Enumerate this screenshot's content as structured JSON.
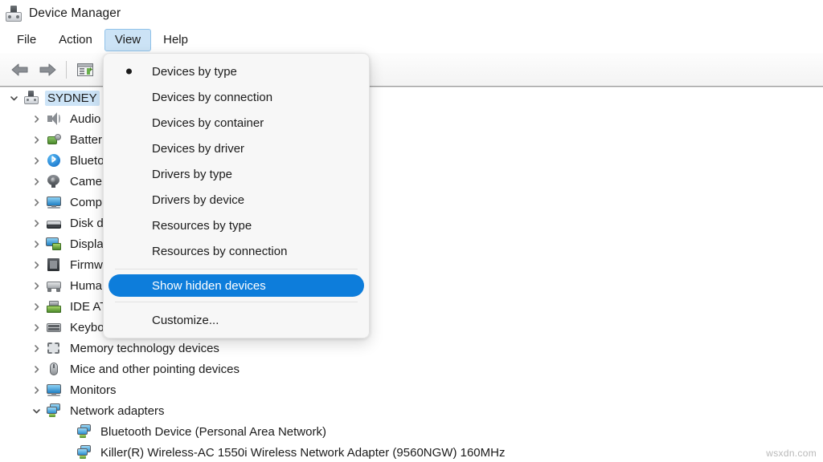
{
  "window": {
    "title": "Device Manager",
    "icon": "device-manager-icon"
  },
  "menubar": {
    "items": [
      {
        "label": "File",
        "open": false
      },
      {
        "label": "Action",
        "open": false
      },
      {
        "label": "View",
        "open": true
      },
      {
        "label": "Help",
        "open": false
      }
    ]
  },
  "toolbar": {
    "buttons": [
      {
        "name": "back-button",
        "icon": "left-arrow-icon"
      },
      {
        "name": "forward-button",
        "icon": "right-arrow-icon"
      },
      {
        "name": "properties-button",
        "icon": "properties-window-icon"
      }
    ]
  },
  "view_menu": {
    "items": [
      {
        "label": "Devices by type",
        "bullet": true,
        "highlight": false,
        "separator_before": false
      },
      {
        "label": "Devices by connection",
        "bullet": false,
        "highlight": false,
        "separator_before": false
      },
      {
        "label": "Devices by container",
        "bullet": false,
        "highlight": false,
        "separator_before": false
      },
      {
        "label": "Devices by driver",
        "bullet": false,
        "highlight": false,
        "separator_before": false
      },
      {
        "label": "Drivers by type",
        "bullet": false,
        "highlight": false,
        "separator_before": false
      },
      {
        "label": "Drivers by device",
        "bullet": false,
        "highlight": false,
        "separator_before": false
      },
      {
        "label": "Resources by type",
        "bullet": false,
        "highlight": false,
        "separator_before": false
      },
      {
        "label": "Resources by connection",
        "bullet": false,
        "highlight": false,
        "separator_before": false
      },
      {
        "label": "Show hidden devices",
        "bullet": false,
        "highlight": true,
        "separator_before": true
      },
      {
        "label": "Customize...",
        "bullet": false,
        "highlight": false,
        "separator_before": true
      }
    ]
  },
  "tree": {
    "rows": [
      {
        "label": "SYDNEY",
        "indent": 0,
        "chevron": "down",
        "icon": "computer-root-icon",
        "selected": true
      },
      {
        "label": "Audio inputs and outputs",
        "indent": 1,
        "chevron": "right",
        "icon": "speaker-icon",
        "selected": false
      },
      {
        "label": "Batteries",
        "indent": 1,
        "chevron": "right",
        "icon": "battery-icon",
        "selected": false
      },
      {
        "label": "Bluetooth",
        "indent": 1,
        "chevron": "right",
        "icon": "bluetooth-icon",
        "selected": false
      },
      {
        "label": "Cameras",
        "indent": 1,
        "chevron": "right",
        "icon": "camera-icon",
        "selected": false
      },
      {
        "label": "Computer",
        "indent": 1,
        "chevron": "right",
        "icon": "monitor-icon",
        "selected": false
      },
      {
        "label": "Disk drives",
        "indent": 1,
        "chevron": "right",
        "icon": "disk-drive-icon",
        "selected": false
      },
      {
        "label": "Display adapters",
        "indent": 1,
        "chevron": "right",
        "icon": "display-adapter-icon",
        "selected": false
      },
      {
        "label": "Firmware",
        "indent": 1,
        "chevron": "right",
        "icon": "firmware-chip-icon",
        "selected": false
      },
      {
        "label": "Human Interface Devices",
        "indent": 1,
        "chevron": "right",
        "icon": "hid-icon",
        "selected": false
      },
      {
        "label": "IDE ATA/ATAPI controllers",
        "indent": 1,
        "chevron": "right",
        "icon": "ide-controller-icon",
        "selected": false
      },
      {
        "label": "Keyboards",
        "indent": 1,
        "chevron": "right",
        "icon": "keyboard-icon",
        "selected": false
      },
      {
        "label": "Memory technology devices",
        "indent": 1,
        "chevron": "right",
        "icon": "memory-tech-icon",
        "selected": false
      },
      {
        "label": "Mice and other pointing devices",
        "indent": 1,
        "chevron": "right",
        "icon": "mouse-icon",
        "selected": false
      },
      {
        "label": "Monitors",
        "indent": 1,
        "chevron": "right",
        "icon": "monitor-icon",
        "selected": false
      },
      {
        "label": "Network adapters",
        "indent": 1,
        "chevron": "down",
        "icon": "network-adapter-icon",
        "selected": false
      },
      {
        "label": "Bluetooth Device (Personal Area Network)",
        "indent": 2,
        "chevron": "none",
        "icon": "network-adapter-icon",
        "selected": false
      },
      {
        "label": "Killer(R) Wireless-AC 1550i Wireless Network Adapter (9560NGW) 160MHz",
        "indent": 2,
        "chevron": "none",
        "icon": "network-adapter-icon",
        "selected": false
      }
    ]
  },
  "watermark": {
    "text": "wsxdn.com"
  },
  "colors": {
    "menu_highlight": "#0d7ddb",
    "menubar_open": "#cce3f6",
    "tree_selection": "#cde4f7",
    "menu_bg": "#f7f7f7",
    "window_bg": "#ffffff"
  }
}
